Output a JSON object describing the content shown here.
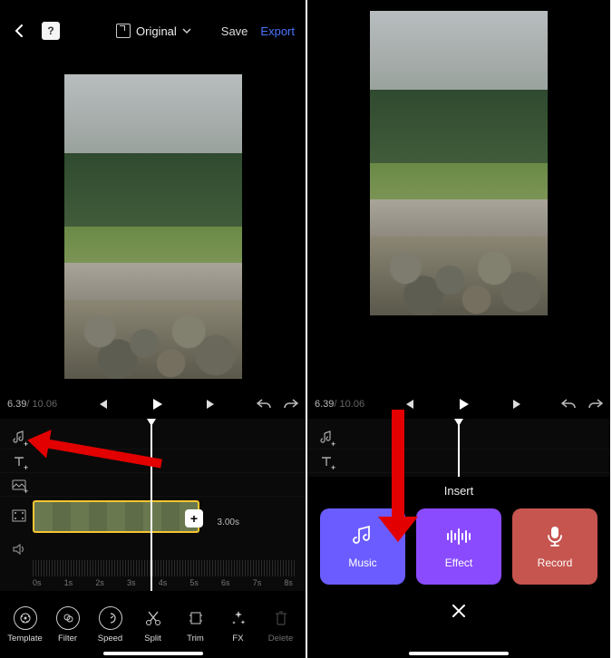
{
  "topbar": {
    "aspect_label": "Original",
    "save_label": "Save",
    "export_label": "Export",
    "help_char": "?"
  },
  "playback": {
    "current": "6.39",
    "separator": " / ",
    "total": "10.06"
  },
  "timeline": {
    "clip_duration": "3.00s",
    "ticks": [
      "0s",
      "1s",
      "2s",
      "3s",
      "4s",
      "5s",
      "6s",
      "7s",
      "8s"
    ]
  },
  "toolbar": {
    "template": "Template",
    "filter": "Filter",
    "speed": "Speed",
    "split": "Split",
    "trim": "Trim",
    "fx": "FX",
    "delete": "Delete"
  },
  "insert": {
    "title": "Insert",
    "music": "Music",
    "effect": "Effect",
    "record": "Record"
  }
}
